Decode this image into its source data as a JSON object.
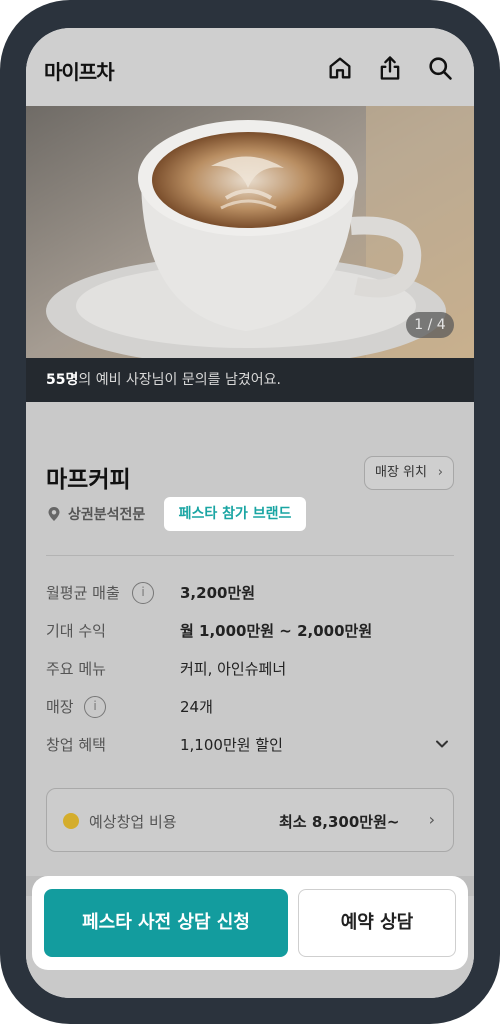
{
  "app": {
    "logo_text": "마이프차"
  },
  "header_icons": [
    "home-icon",
    "share-icon",
    "search-icon"
  ],
  "hero": {
    "image_counter": "1 / 4"
  },
  "inquiry": {
    "count": "55명",
    "text": "의 예비 사장님이 문의를 남겼어요."
  },
  "store": {
    "name": "마프커피",
    "location_button": "매장 위치",
    "category": "상권분석전문",
    "badge": "페스타 참가 브랜드"
  },
  "details": [
    {
      "label": "월평균 매출",
      "value": "3,200만원"
    },
    {
      "label": "기대 수익",
      "value": "월 1,000만원 ~ 2,000만원"
    },
    {
      "label": "주요 메뉴",
      "value": "커피, 아인슈페너"
    },
    {
      "label": "매장",
      "value": "24개"
    },
    {
      "label": "창업 혜택",
      "value": "1,100만원 할인"
    }
  ],
  "cost": {
    "label": "예상창업 비용",
    "value": "최소 8,300만원~"
  },
  "cta": {
    "primary": "페스타 사전 상담 신청",
    "secondary": "예약 상담"
  },
  "colors": {
    "accent": "#139c9e",
    "badge_text": "#1aa5a3",
    "cost_dot": "#d4ad2c",
    "frame": "#2b333d"
  }
}
